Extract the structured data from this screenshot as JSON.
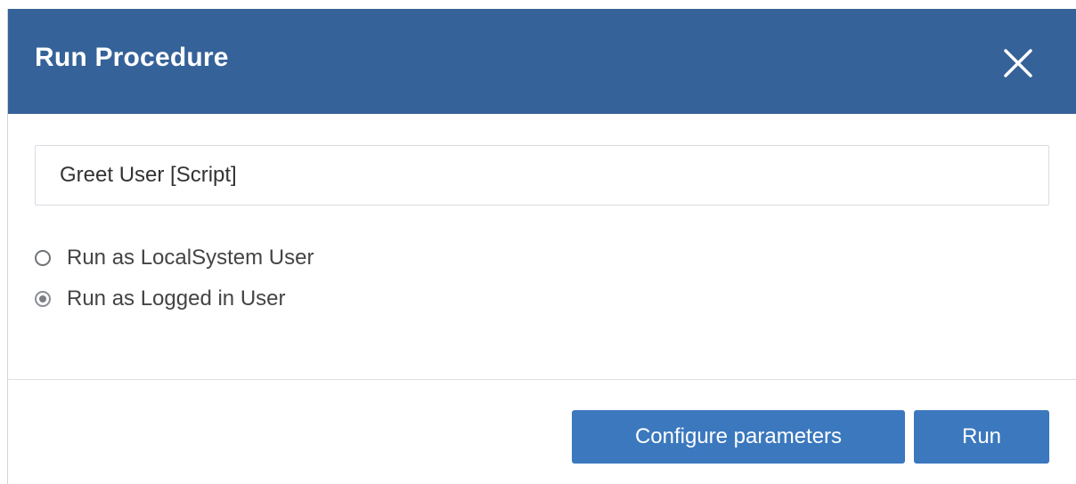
{
  "dialog": {
    "title": "Run Procedure",
    "close_icon": "close-icon"
  },
  "procedure": {
    "value": "Greet User [Script]"
  },
  "run_as": {
    "options": [
      {
        "label": "Run as LocalSystem User",
        "checked": false
      },
      {
        "label": "Run as Logged in User",
        "checked": true
      }
    ]
  },
  "footer": {
    "configure_label": "Configure parameters",
    "run_label": "Run"
  },
  "colors": {
    "header": "#356298",
    "button": "#3b78be"
  }
}
